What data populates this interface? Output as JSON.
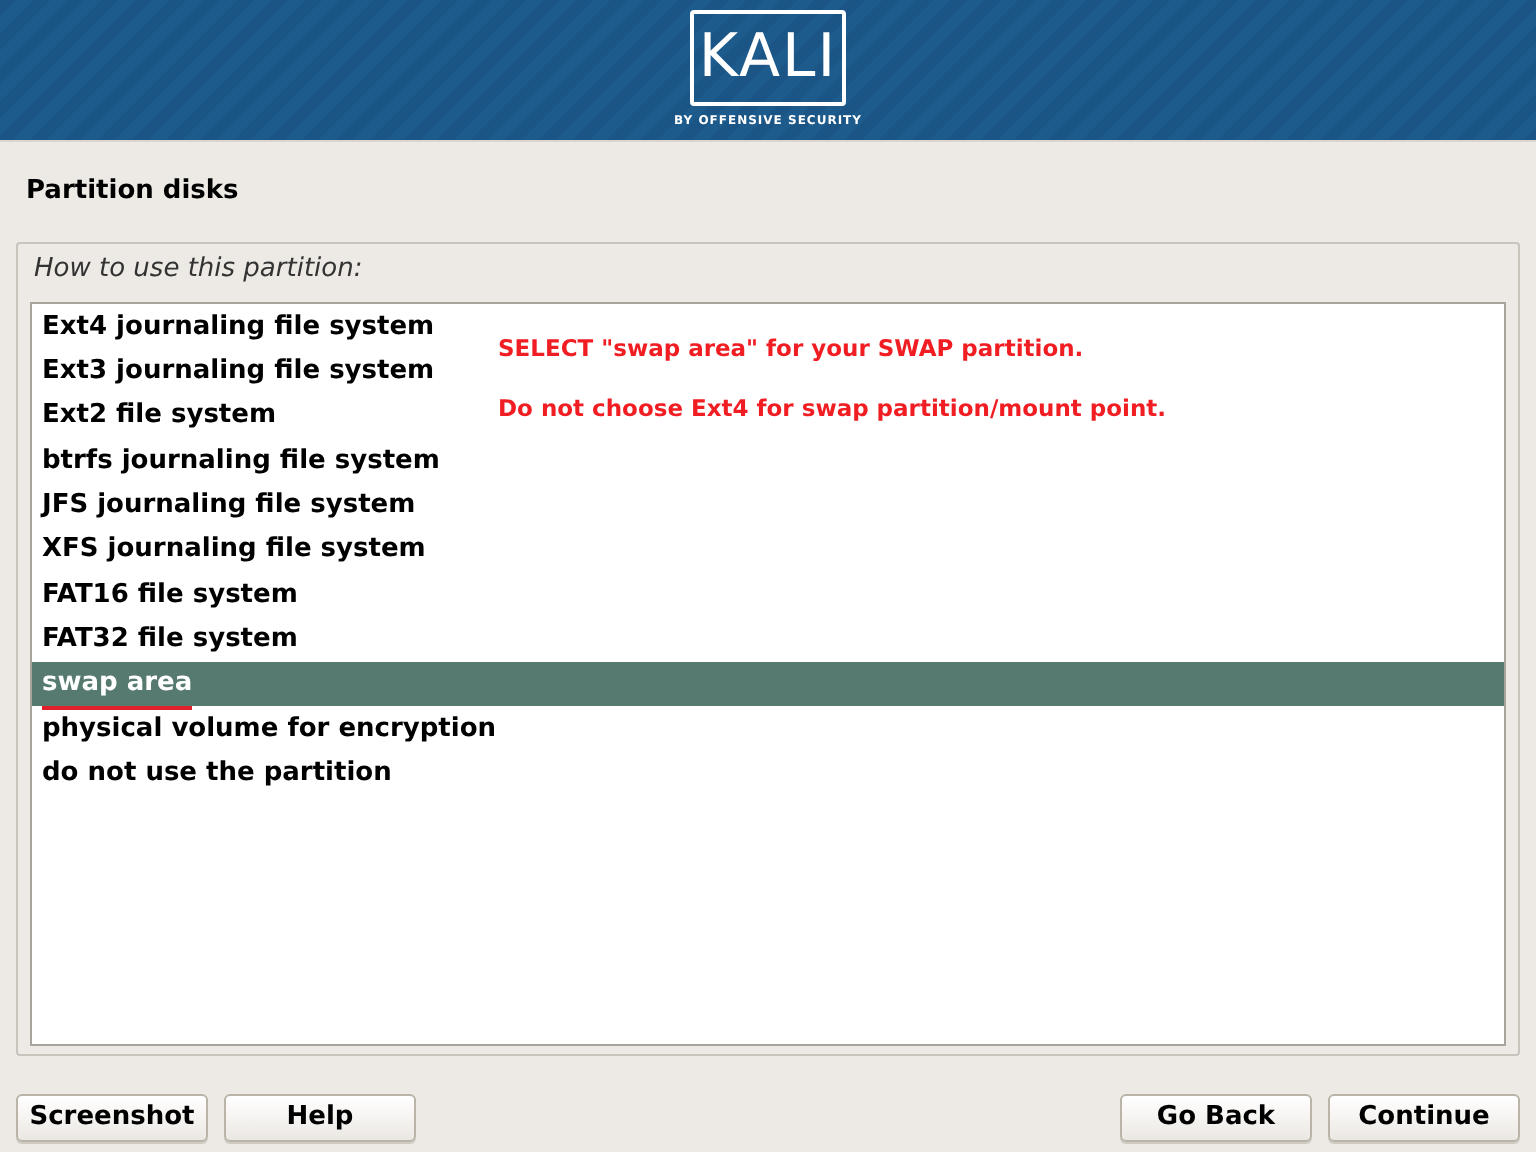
{
  "header": {
    "logo": "KALI",
    "tagline": "BY OFFENSIVE SECURITY"
  },
  "title": "Partition disks",
  "question": "How to use this partition:",
  "options": [
    {
      "label": "Ext4 journaling file system",
      "selected": false
    },
    {
      "label": "Ext3 journaling file system",
      "selected": false
    },
    {
      "label": "Ext2 file system",
      "selected": false
    },
    {
      "label": "btrfs journaling file system",
      "selected": false
    },
    {
      "label": "JFS journaling file system",
      "selected": false
    },
    {
      "label": "XFS journaling file system",
      "selected": false
    },
    {
      "label": "FAT16 file system",
      "selected": false
    },
    {
      "label": "FAT32 file system",
      "selected": false
    },
    {
      "label": "swap area",
      "selected": true
    },
    {
      "label": "physical volume for encryption",
      "selected": false
    },
    {
      "label": "do not use the partition",
      "selected": false
    }
  ],
  "notes": [
    "SELECT \"swap area\" for your SWAP partition.",
    "Do not choose Ext4 for swap partition/mount point."
  ],
  "buttons_left": [
    "Screenshot",
    "Help"
  ],
  "buttons_right": [
    "Go Back",
    "Continue"
  ]
}
